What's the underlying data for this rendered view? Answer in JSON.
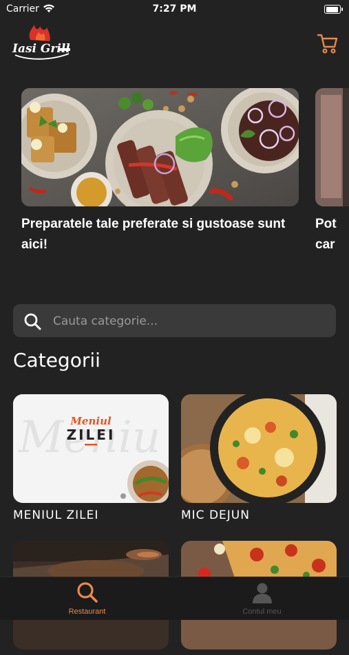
{
  "status_bar": {
    "carrier": "Carrier",
    "time": "7:27 PM"
  },
  "header": {
    "logo_text": "Iasi Grill"
  },
  "carousel": {
    "slides": [
      {
        "caption": "Preparatele tale preferate si gustoase sunt aici!"
      },
      {
        "caption": "Pot car"
      }
    ]
  },
  "search": {
    "placeholder": "Cauta categorie..."
  },
  "categories_title": "Categorii",
  "categories": [
    {
      "label": "MENIUL ZILEI",
      "image_title_top": "Meniul",
      "image_title_bottom": "ZILEI",
      "image_watermark": "Meniu"
    },
    {
      "label": "MIC DEJUN"
    },
    {
      "label": ""
    },
    {
      "label": ""
    }
  ],
  "tabs": [
    {
      "label": "Restaurant",
      "icon": "search-icon",
      "active": true
    },
    {
      "label": "Contul meu",
      "icon": "user-icon",
      "active": false
    }
  ],
  "colors": {
    "accent": "#e88a4a",
    "background": "#222222",
    "tab_inactive": "#555555"
  }
}
